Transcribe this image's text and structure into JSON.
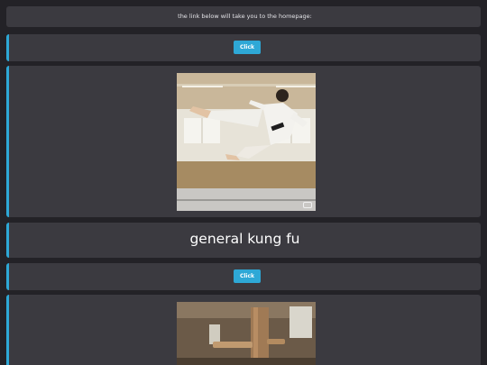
{
  "intro": {
    "text": "the link below will take you to the homepage:"
  },
  "buttons": {
    "first_label": "Click",
    "second_label": "Click"
  },
  "heading": {
    "text": "general kung fu"
  },
  "images": {
    "kick_photo_icon": "image-badge-icon",
    "training_photo_icon": "wooden-dummy-photo"
  },
  "colors": {
    "background": "#232227",
    "card": "#3b3a40",
    "accent": "#2ea8d6"
  }
}
